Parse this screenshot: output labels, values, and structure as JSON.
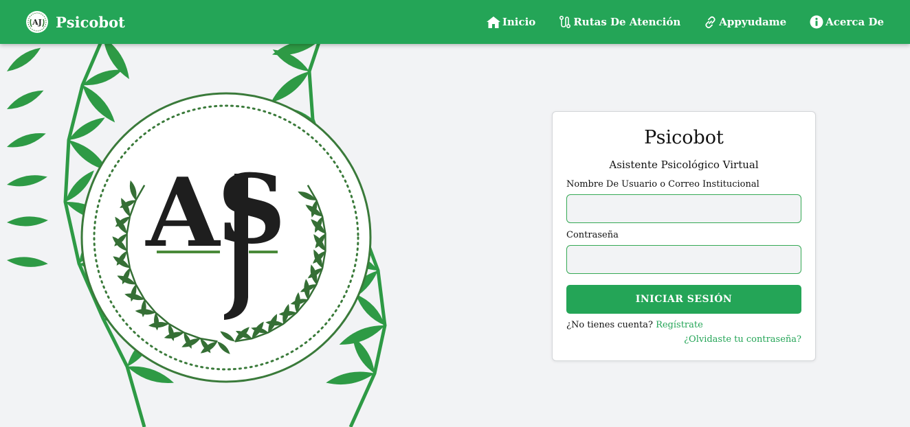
{
  "navbar": {
    "brand": {
      "name": "Psicobot",
      "logo_text": "AJS"
    },
    "items": [
      {
        "label": "Inicio",
        "icon": "home-icon"
      },
      {
        "label": "Rutas De Atención",
        "icon": "route-icon"
      },
      {
        "label": "Appyudame",
        "icon": "link-icon"
      },
      {
        "label": "Acerca De",
        "icon": "info-icon"
      }
    ]
  },
  "hero": {
    "emblem_text": "AJS"
  },
  "login": {
    "title": "Psicobot",
    "subtitle": "Asistente Psicológico Virtual",
    "username_label": "Nombre De Usuario o Correo Institucional",
    "username_value": "",
    "password_label": "Contraseña",
    "password_value": "",
    "submit_label": "INICIAR SESIÓN",
    "no_account_text": "¿No tienes cuenta?",
    "register_link": "Regístrate",
    "forgot_link": "¿Olvidaste tu contraseña?"
  },
  "colors": {
    "primary": "#24a557",
    "leaf_light": "#2e9a45",
    "leaf_dark": "#356f35",
    "background": "#f2f3f5"
  }
}
